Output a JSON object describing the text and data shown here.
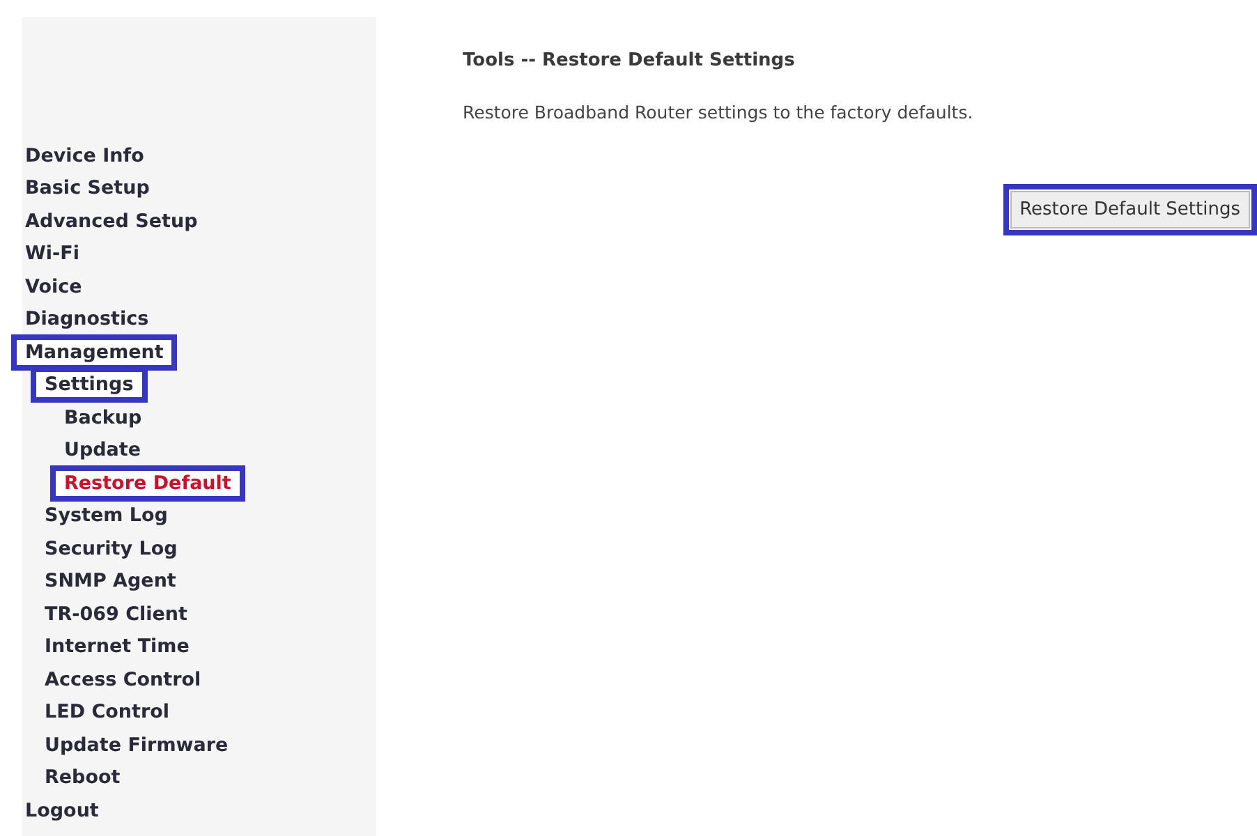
{
  "sidebar": {
    "items": [
      {
        "label": "Device Info",
        "selected": false,
        "highlighted": false
      },
      {
        "label": "Basic Setup",
        "selected": false,
        "highlighted": false
      },
      {
        "label": "Advanced Setup",
        "selected": false,
        "highlighted": false
      },
      {
        "label": "Wi-Fi",
        "selected": false,
        "highlighted": false
      },
      {
        "label": "Voice",
        "selected": false,
        "highlighted": false
      },
      {
        "label": "Diagnostics",
        "selected": false,
        "highlighted": false
      },
      {
        "label": "Management",
        "selected": false,
        "highlighted": true,
        "children": [
          {
            "label": "Settings",
            "selected": false,
            "highlighted": true,
            "children": [
              {
                "label": "Backup",
                "selected": false,
                "highlighted": false
              },
              {
                "label": "Update",
                "selected": false,
                "highlighted": false
              },
              {
                "label": "Restore Default",
                "selected": true,
                "highlighted": true
              }
            ]
          },
          {
            "label": "System Log",
            "selected": false,
            "highlighted": false
          },
          {
            "label": "Security Log",
            "selected": false,
            "highlighted": false
          },
          {
            "label": "SNMP Agent",
            "selected": false,
            "highlighted": false
          },
          {
            "label": "TR-069 Client",
            "selected": false,
            "highlighted": false
          },
          {
            "label": "Internet Time",
            "selected": false,
            "highlighted": false
          },
          {
            "label": "Access Control",
            "selected": false,
            "highlighted": false
          },
          {
            "label": "LED Control",
            "selected": false,
            "highlighted": false
          },
          {
            "label": "Update Firmware",
            "selected": false,
            "highlighted": false
          },
          {
            "label": "Reboot",
            "selected": false,
            "highlighted": false
          }
        ]
      },
      {
        "label": "Logout",
        "selected": false,
        "highlighted": false
      }
    ]
  },
  "content": {
    "title": "Tools -- Restore Default Settings",
    "description": "Restore Broadband Router settings to the factory defaults.",
    "button": {
      "label": "Restore Default Settings",
      "highlighted": true
    }
  }
}
